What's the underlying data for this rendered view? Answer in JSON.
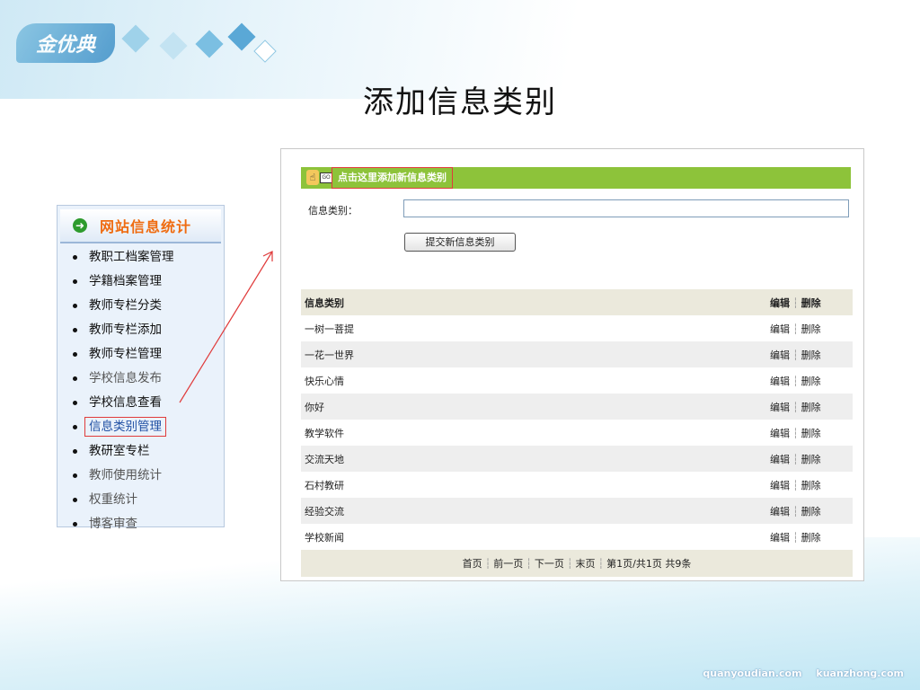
{
  "slide": {
    "title": "添加信息类别",
    "logo_text": "金优典"
  },
  "sidebar": {
    "header": "网站信息统计",
    "items": [
      {
        "label": "教职工档案管理"
      },
      {
        "label": "学籍档案管理"
      },
      {
        "label": "教师专栏分类"
      },
      {
        "label": "教师专栏添加"
      },
      {
        "label": "教师专栏管理"
      },
      {
        "label": "学校信息发布"
      },
      {
        "label": "学校信息查看"
      },
      {
        "label": "信息类别管理"
      },
      {
        "label": "教研室专栏"
      },
      {
        "label": "教师使用统计"
      },
      {
        "label": "权重统计"
      },
      {
        "label": "博客审查"
      }
    ]
  },
  "panel": {
    "add_link": "点击这里添加新信息类别",
    "form_label": "信息类别：",
    "input_value": "",
    "submit_label": "提交新信息类别",
    "table": {
      "col_name": "信息类别",
      "col_edit": "编辑",
      "col_delete": "删除",
      "rows": [
        {
          "name": "一树一菩提",
          "edit": "编辑",
          "delete": "删除"
        },
        {
          "name": "一花一世界",
          "edit": "编辑",
          "delete": "删除"
        },
        {
          "name": "快乐心情",
          "edit": "编辑",
          "delete": "删除"
        },
        {
          "name": "你好",
          "edit": "编辑",
          "delete": "删除"
        },
        {
          "name": "教学软件",
          "edit": "编辑",
          "delete": "删除"
        },
        {
          "name": "交流天地",
          "edit": "编辑",
          "delete": "删除"
        },
        {
          "name": "石村教研",
          "edit": "编辑",
          "delete": "删除"
        },
        {
          "name": "经验交流",
          "edit": "编辑",
          "delete": "删除"
        },
        {
          "name": "学校新闻",
          "edit": "编辑",
          "delete": "删除"
        }
      ]
    },
    "pager": {
      "first": "首页",
      "prev": "前一页",
      "next": "下一页",
      "last": "末页",
      "page_info": "第1页/共1页",
      "total": "共9条"
    }
  },
  "footer": {
    "site1": "quanyoudian.com",
    "site2": "kuanzhong.com"
  },
  "colors": {
    "green_bar": "#8dc33a",
    "highlight_border": "#e03b3b",
    "menu_header": "#ef6b10"
  },
  "icons": [
    "hand-icon",
    "box-icon",
    "arrow-right-icon"
  ]
}
